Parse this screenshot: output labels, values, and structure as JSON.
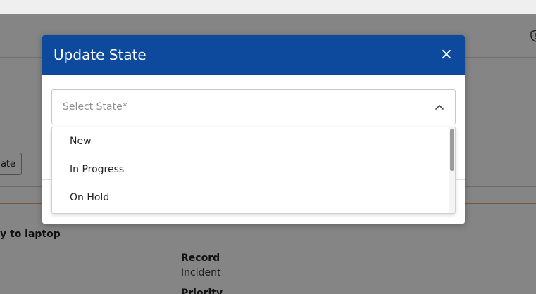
{
  "background": {
    "button_fragment": "ate",
    "row_text": "y to laptop",
    "record_label": "Record",
    "record_value": "Incident",
    "priority_label": "Priority"
  },
  "modal": {
    "title": "Update State",
    "close_glyph": "×",
    "select": {
      "placeholder": "Select State*",
      "expanded": true
    },
    "options": [
      "New",
      "In Progress",
      "On Hold"
    ]
  },
  "colors": {
    "header_blue": "#0d4a9e",
    "accent_orange": "#e6a772"
  },
  "icons": {
    "close": "close-icon",
    "chevron": "chevron-up-icon",
    "shield": "shield-icon"
  }
}
